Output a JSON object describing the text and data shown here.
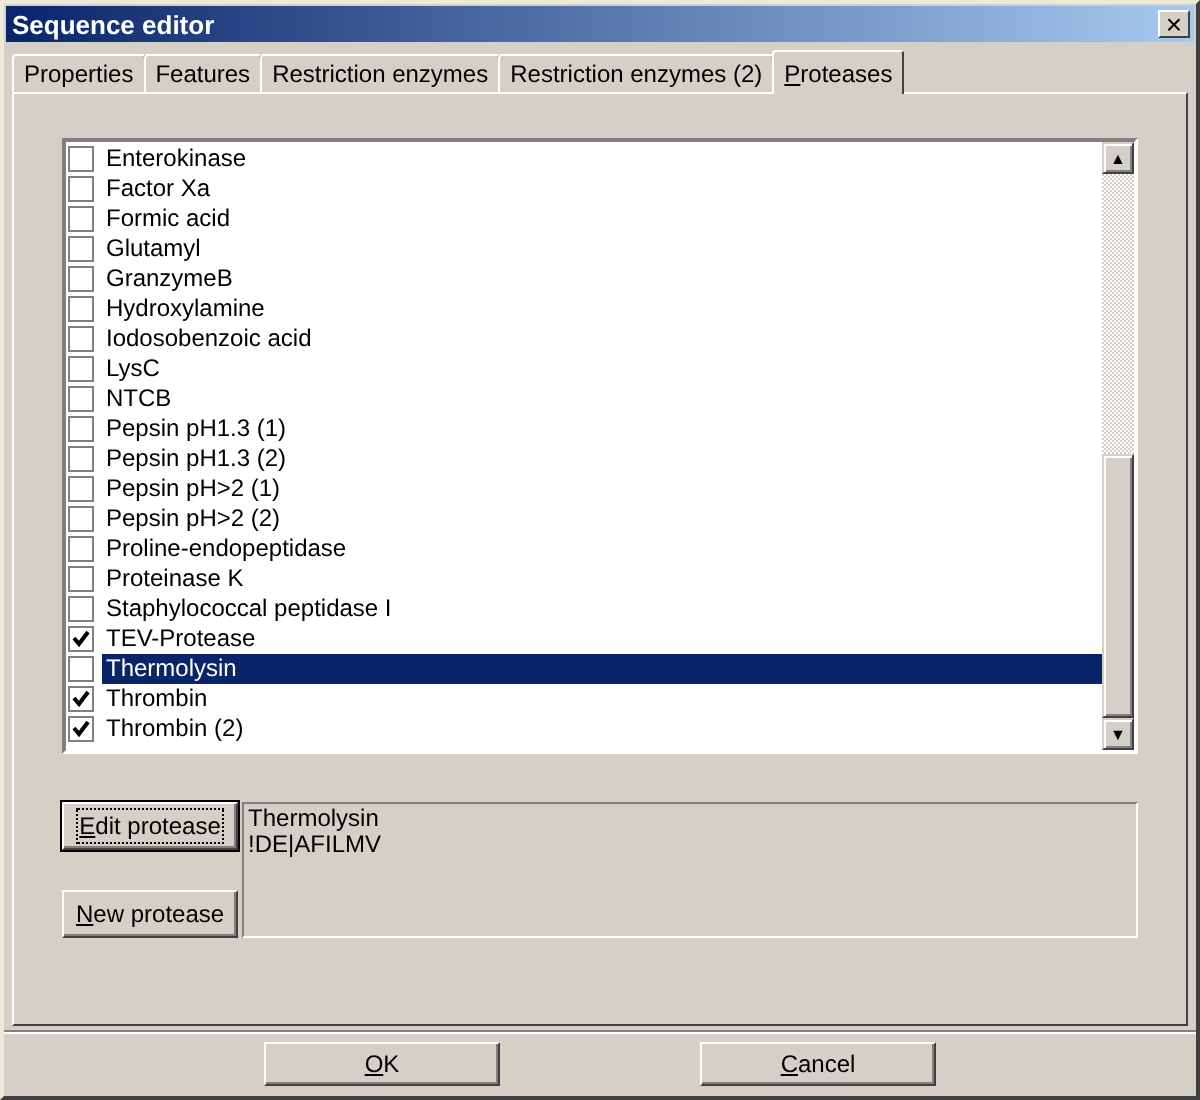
{
  "window": {
    "title": "Sequence editor",
    "close": "×"
  },
  "tabs": [
    {
      "label": "Properties",
      "selected": false,
      "mnemonic": false
    },
    {
      "label": "Features",
      "selected": false,
      "mnemonic": false
    },
    {
      "label": "Restriction enzymes",
      "selected": false,
      "mnemonic": false
    },
    {
      "label": "Restriction enzymes (2)",
      "selected": false,
      "mnemonic": false
    },
    {
      "label": "Proteases",
      "selected": true,
      "mnemonic": true
    }
  ],
  "proteases": [
    {
      "name": "Enterokinase",
      "checked": false,
      "selected": false
    },
    {
      "name": "Factor Xa",
      "checked": false,
      "selected": false
    },
    {
      "name": "Formic acid",
      "checked": false,
      "selected": false
    },
    {
      "name": "Glutamyl",
      "checked": false,
      "selected": false
    },
    {
      "name": "GranzymeB",
      "checked": false,
      "selected": false
    },
    {
      "name": "Hydroxylamine",
      "checked": false,
      "selected": false
    },
    {
      "name": "Iodosobenzoic acid",
      "checked": false,
      "selected": false
    },
    {
      "name": "LysC",
      "checked": false,
      "selected": false
    },
    {
      "name": "NTCB",
      "checked": false,
      "selected": false
    },
    {
      "name": "Pepsin pH1.3 (1)",
      "checked": false,
      "selected": false
    },
    {
      "name": "Pepsin pH1.3 (2)",
      "checked": false,
      "selected": false
    },
    {
      "name": "Pepsin pH>2 (1)",
      "checked": false,
      "selected": false
    },
    {
      "name": "Pepsin pH>2 (2)",
      "checked": false,
      "selected": false
    },
    {
      "name": "Proline-endopeptidase",
      "checked": false,
      "selected": false
    },
    {
      "name": "Proteinase K",
      "checked": false,
      "selected": false
    },
    {
      "name": "Staphylococcal peptidase I",
      "checked": false,
      "selected": false
    },
    {
      "name": "TEV-Protease",
      "checked": true,
      "selected": false
    },
    {
      "name": "Thermolysin",
      "checked": false,
      "selected": true
    },
    {
      "name": "Thrombin",
      "checked": true,
      "selected": false
    },
    {
      "name": "Thrombin (2)",
      "checked": true,
      "selected": false
    }
  ],
  "scrollbar": {
    "up": "▲",
    "down": "▼"
  },
  "edit_button": {
    "label": "Edit protease",
    "mnemonic": true,
    "focused": true
  },
  "new_button": {
    "label": "New protease",
    "mnemonic": true,
    "focused": false
  },
  "details": [
    "Thermolysin",
    "!DE|AFILMV"
  ],
  "footer_buttons": [
    {
      "label": "OK",
      "mnemonic": true
    },
    {
      "label": "Cancel",
      "mnemonic": true
    }
  ]
}
